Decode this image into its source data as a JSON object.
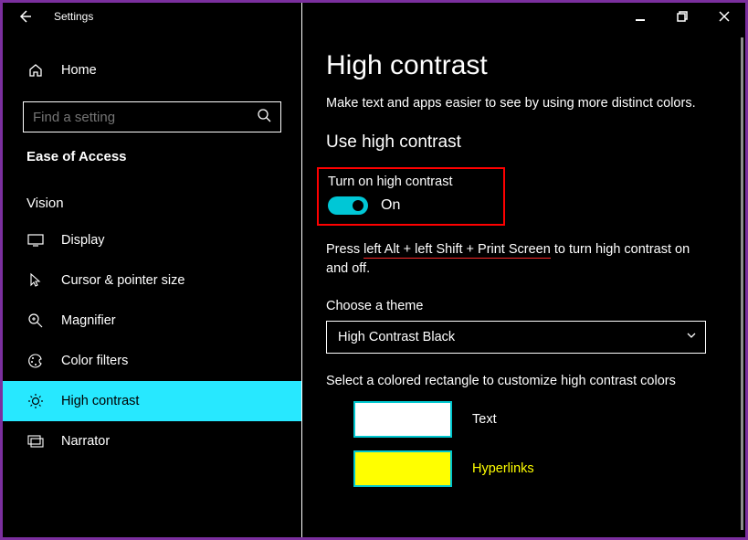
{
  "window": {
    "title": "Settings",
    "controls": {
      "minimize": "–",
      "restore": "❐",
      "close": "✕"
    }
  },
  "sidebar": {
    "home_label": "Home",
    "search_placeholder": "Find a setting",
    "section_label": "Ease of Access",
    "group_label": "Vision",
    "items": [
      {
        "label": "Display"
      },
      {
        "label": "Cursor & pointer size"
      },
      {
        "label": "Magnifier"
      },
      {
        "label": "Color filters"
      },
      {
        "label": "High contrast"
      },
      {
        "label": "Narrator"
      }
    ]
  },
  "main": {
    "title": "High contrast",
    "description": "Make text and apps easier to see by using more distinct colors.",
    "section1_title": "Use high contrast",
    "toggle": {
      "label": "Turn on high contrast",
      "state_text": "On"
    },
    "hotkey_prefix": "Press ",
    "hotkey_keys": "left Alt + left Shift + Print Screen",
    "hotkey_suffix": " to turn high contrast on and off.",
    "theme_label": "Choose a theme",
    "theme_value": "High Contrast Black",
    "swatch_instruction": "Select a colored rectangle to customize high contrast colors",
    "swatches": {
      "text": "Text",
      "hyperlinks": "Hyperlinks"
    }
  },
  "colors": {
    "accent": "#27e8ff",
    "swatch_border": "#00c7cf",
    "annotation": "#ff0000"
  }
}
